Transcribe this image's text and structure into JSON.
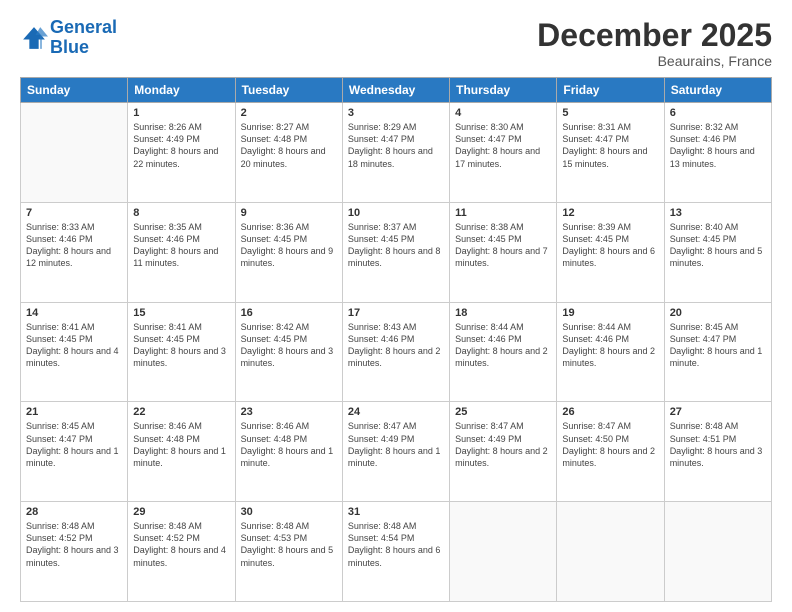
{
  "logo": {
    "line1": "General",
    "line2": "Blue"
  },
  "title": "December 2025",
  "location": "Beaurains, France",
  "header_days": [
    "Sunday",
    "Monday",
    "Tuesday",
    "Wednesday",
    "Thursday",
    "Friday",
    "Saturday"
  ],
  "weeks": [
    [
      {
        "day": "",
        "sunrise": "",
        "sunset": "",
        "daylight": ""
      },
      {
        "day": "1",
        "sunrise": "Sunrise: 8:26 AM",
        "sunset": "Sunset: 4:49 PM",
        "daylight": "Daylight: 8 hours and 22 minutes."
      },
      {
        "day": "2",
        "sunrise": "Sunrise: 8:27 AM",
        "sunset": "Sunset: 4:48 PM",
        "daylight": "Daylight: 8 hours and 20 minutes."
      },
      {
        "day": "3",
        "sunrise": "Sunrise: 8:29 AM",
        "sunset": "Sunset: 4:47 PM",
        "daylight": "Daylight: 8 hours and 18 minutes."
      },
      {
        "day": "4",
        "sunrise": "Sunrise: 8:30 AM",
        "sunset": "Sunset: 4:47 PM",
        "daylight": "Daylight: 8 hours and 17 minutes."
      },
      {
        "day": "5",
        "sunrise": "Sunrise: 8:31 AM",
        "sunset": "Sunset: 4:47 PM",
        "daylight": "Daylight: 8 hours and 15 minutes."
      },
      {
        "day": "6",
        "sunrise": "Sunrise: 8:32 AM",
        "sunset": "Sunset: 4:46 PM",
        "daylight": "Daylight: 8 hours and 13 minutes."
      }
    ],
    [
      {
        "day": "7",
        "sunrise": "Sunrise: 8:33 AM",
        "sunset": "Sunset: 4:46 PM",
        "daylight": "Daylight: 8 hours and 12 minutes."
      },
      {
        "day": "8",
        "sunrise": "Sunrise: 8:35 AM",
        "sunset": "Sunset: 4:46 PM",
        "daylight": "Daylight: 8 hours and 11 minutes."
      },
      {
        "day": "9",
        "sunrise": "Sunrise: 8:36 AM",
        "sunset": "Sunset: 4:45 PM",
        "daylight": "Daylight: 8 hours and 9 minutes."
      },
      {
        "day": "10",
        "sunrise": "Sunrise: 8:37 AM",
        "sunset": "Sunset: 4:45 PM",
        "daylight": "Daylight: 8 hours and 8 minutes."
      },
      {
        "day": "11",
        "sunrise": "Sunrise: 8:38 AM",
        "sunset": "Sunset: 4:45 PM",
        "daylight": "Daylight: 8 hours and 7 minutes."
      },
      {
        "day": "12",
        "sunrise": "Sunrise: 8:39 AM",
        "sunset": "Sunset: 4:45 PM",
        "daylight": "Daylight: 8 hours and 6 minutes."
      },
      {
        "day": "13",
        "sunrise": "Sunrise: 8:40 AM",
        "sunset": "Sunset: 4:45 PM",
        "daylight": "Daylight: 8 hours and 5 minutes."
      }
    ],
    [
      {
        "day": "14",
        "sunrise": "Sunrise: 8:41 AM",
        "sunset": "Sunset: 4:45 PM",
        "daylight": "Daylight: 8 hours and 4 minutes."
      },
      {
        "day": "15",
        "sunrise": "Sunrise: 8:41 AM",
        "sunset": "Sunset: 4:45 PM",
        "daylight": "Daylight: 8 hours and 3 minutes."
      },
      {
        "day": "16",
        "sunrise": "Sunrise: 8:42 AM",
        "sunset": "Sunset: 4:45 PM",
        "daylight": "Daylight: 8 hours and 3 minutes."
      },
      {
        "day": "17",
        "sunrise": "Sunrise: 8:43 AM",
        "sunset": "Sunset: 4:46 PM",
        "daylight": "Daylight: 8 hours and 2 minutes."
      },
      {
        "day": "18",
        "sunrise": "Sunrise: 8:44 AM",
        "sunset": "Sunset: 4:46 PM",
        "daylight": "Daylight: 8 hours and 2 minutes."
      },
      {
        "day": "19",
        "sunrise": "Sunrise: 8:44 AM",
        "sunset": "Sunset: 4:46 PM",
        "daylight": "Daylight: 8 hours and 2 minutes."
      },
      {
        "day": "20",
        "sunrise": "Sunrise: 8:45 AM",
        "sunset": "Sunset: 4:47 PM",
        "daylight": "Daylight: 8 hours and 1 minute."
      }
    ],
    [
      {
        "day": "21",
        "sunrise": "Sunrise: 8:45 AM",
        "sunset": "Sunset: 4:47 PM",
        "daylight": "Daylight: 8 hours and 1 minute."
      },
      {
        "day": "22",
        "sunrise": "Sunrise: 8:46 AM",
        "sunset": "Sunset: 4:48 PM",
        "daylight": "Daylight: 8 hours and 1 minute."
      },
      {
        "day": "23",
        "sunrise": "Sunrise: 8:46 AM",
        "sunset": "Sunset: 4:48 PM",
        "daylight": "Daylight: 8 hours and 1 minute."
      },
      {
        "day": "24",
        "sunrise": "Sunrise: 8:47 AM",
        "sunset": "Sunset: 4:49 PM",
        "daylight": "Daylight: 8 hours and 1 minute."
      },
      {
        "day": "25",
        "sunrise": "Sunrise: 8:47 AM",
        "sunset": "Sunset: 4:49 PM",
        "daylight": "Daylight: 8 hours and 2 minutes."
      },
      {
        "day": "26",
        "sunrise": "Sunrise: 8:47 AM",
        "sunset": "Sunset: 4:50 PM",
        "daylight": "Daylight: 8 hours and 2 minutes."
      },
      {
        "day": "27",
        "sunrise": "Sunrise: 8:48 AM",
        "sunset": "Sunset: 4:51 PM",
        "daylight": "Daylight: 8 hours and 3 minutes."
      }
    ],
    [
      {
        "day": "28",
        "sunrise": "Sunrise: 8:48 AM",
        "sunset": "Sunset: 4:52 PM",
        "daylight": "Daylight: 8 hours and 3 minutes."
      },
      {
        "day": "29",
        "sunrise": "Sunrise: 8:48 AM",
        "sunset": "Sunset: 4:52 PM",
        "daylight": "Daylight: 8 hours and 4 minutes."
      },
      {
        "day": "30",
        "sunrise": "Sunrise: 8:48 AM",
        "sunset": "Sunset: 4:53 PM",
        "daylight": "Daylight: 8 hours and 5 minutes."
      },
      {
        "day": "31",
        "sunrise": "Sunrise: 8:48 AM",
        "sunset": "Sunset: 4:54 PM",
        "daylight": "Daylight: 8 hours and 6 minutes."
      },
      {
        "day": "",
        "sunrise": "",
        "sunset": "",
        "daylight": ""
      },
      {
        "day": "",
        "sunrise": "",
        "sunset": "",
        "daylight": ""
      },
      {
        "day": "",
        "sunrise": "",
        "sunset": "",
        "daylight": ""
      }
    ]
  ]
}
